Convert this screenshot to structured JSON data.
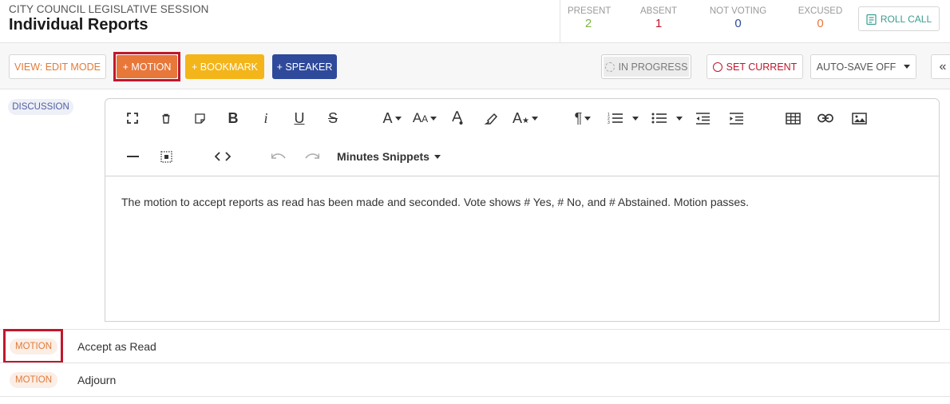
{
  "header": {
    "session_label": "CITY COUNCIL LEGISLATIVE SESSION",
    "title": "Individual Reports",
    "stats": [
      {
        "label": "PRESENT",
        "value": "2",
        "color": "#7cb342"
      },
      {
        "label": "ABSENT",
        "value": "1",
        "color": "#c0182c"
      },
      {
        "label": "NOT VOTING",
        "value": "0",
        "color": "#2f4a9a"
      },
      {
        "label": "EXCUSED",
        "value": "0",
        "color": "#e8773a"
      }
    ],
    "roll_call_label": "ROLL CALL"
  },
  "toolbar": {
    "view_mode_label": "VIEW: EDIT MODE",
    "motion_label": "+ MOTION",
    "bookmark_label": "+ BOOKMARK",
    "speaker_label": "+ SPEAKER",
    "in_progress_label": "IN PROGRESS",
    "set_current_label": "SET CURRENT",
    "autosave_label": "AUTO-SAVE OFF",
    "collapse_label": "«"
  },
  "discussion": {
    "badge": "DISCUSSION",
    "editor": {
      "snippets_label": "Minutes Snippets",
      "content": "The motion to accept reports as read has been made and seconded. Vote shows # Yes, # No, and # Abstained. Motion passes."
    }
  },
  "motions": [
    {
      "badge": "MOTION",
      "text": "Accept as Read"
    },
    {
      "badge": "MOTION",
      "text": "Adjourn"
    }
  ],
  "colors": {
    "accent_orange": "#e8773a",
    "bookmark_yellow": "#f3b51a",
    "speaker_blue": "#2f4a9a",
    "highlight_red": "#c0182c",
    "roll_call_teal": "#3a9d8f"
  }
}
